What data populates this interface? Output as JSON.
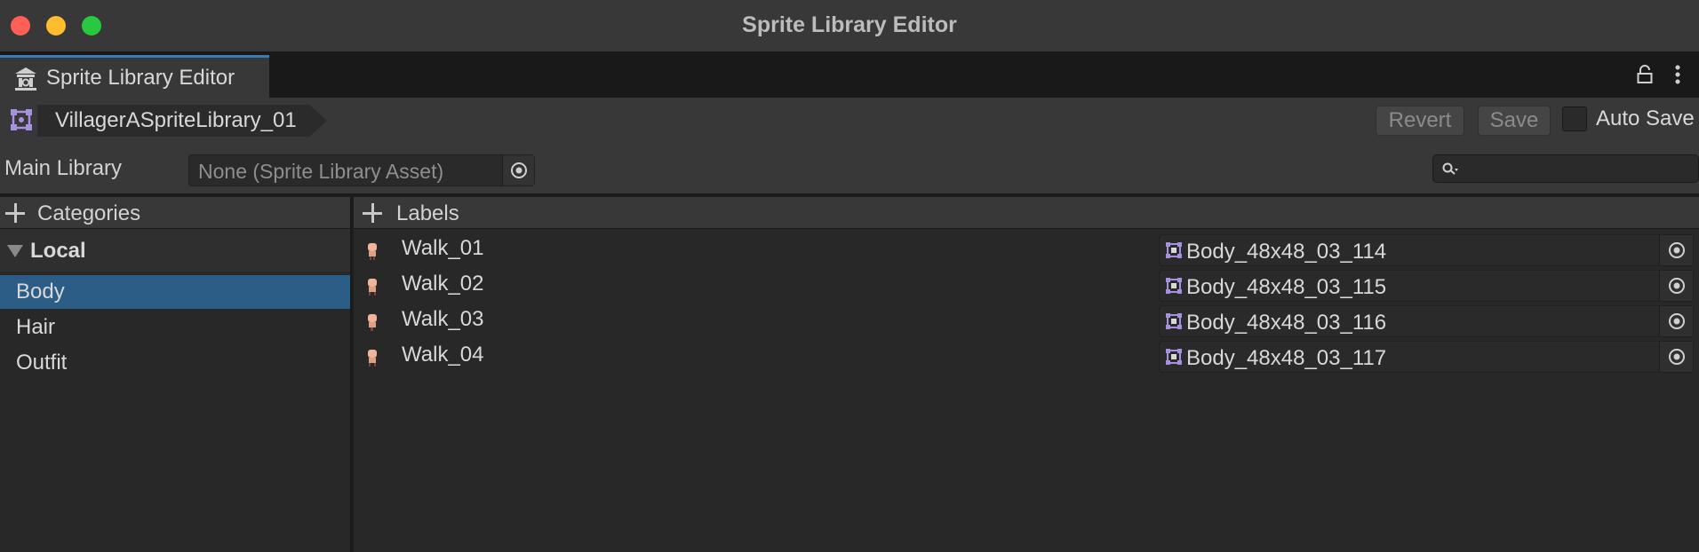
{
  "window": {
    "title": "Sprite Library Editor"
  },
  "tab": {
    "label": "Sprite Library Editor",
    "icon": "sprite-library-icon"
  },
  "toolbar": {
    "asset_name": "VillagerASpriteLibrary_01",
    "revert_label": "Revert",
    "save_label": "Save",
    "auto_save_label": "Auto Save",
    "auto_save_checked": false
  },
  "main_library": {
    "label": "Main Library",
    "value": "None (Sprite Library Asset)"
  },
  "search": {
    "value": ""
  },
  "categories": {
    "header": "Categories",
    "group": "Local",
    "items": [
      {
        "label": "Body",
        "selected": true
      },
      {
        "label": "Hair",
        "selected": false
      },
      {
        "label": "Outfit",
        "selected": false
      }
    ]
  },
  "labels": {
    "header": "Labels",
    "rows": [
      {
        "name": "Walk_01",
        "sprite": "Body_48x48_03_114"
      },
      {
        "name": "Walk_02",
        "sprite": "Body_48x48_03_115"
      },
      {
        "name": "Walk_03",
        "sprite": "Body_48x48_03_116"
      },
      {
        "name": "Walk_04",
        "sprite": "Body_48x48_03_117"
      }
    ]
  },
  "colors": {
    "selection": "#2c5d87",
    "tab_accent": "#3a79bb",
    "asset_icon": "#a890e0"
  }
}
